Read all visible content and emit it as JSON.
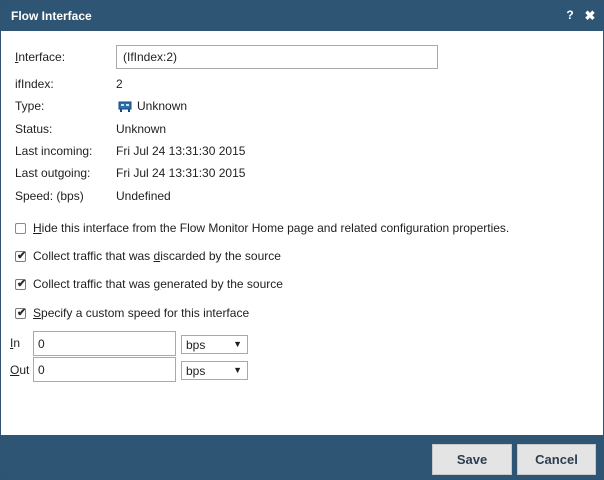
{
  "dialog": {
    "title": "Flow Interface",
    "help": "?",
    "close": "✖"
  },
  "fields": {
    "interface": {
      "label_prefix": "I",
      "label_rest": "nterface:",
      "value": "(IfIndex:2)"
    },
    "ifindex": {
      "label": "ifIndex:",
      "value": "2"
    },
    "type": {
      "label": "Type:",
      "value": "Unknown",
      "icon": "network-card-icon"
    },
    "status": {
      "label": "Status:",
      "value": "Unknown"
    },
    "last_incoming": {
      "label": "Last incoming:",
      "value": "Fri Jul 24 13:31:30 2015"
    },
    "last_outgoing": {
      "label": "Last outgoing:",
      "value": "Fri Jul 24 13:31:30 2015"
    },
    "speed": {
      "label": "Speed: (bps)",
      "value": "Undefined"
    }
  },
  "options": {
    "hide": {
      "checked": false,
      "pre": "",
      "u": "H",
      "post": "ide this interface from the Flow Monitor Home page and related configuration properties."
    },
    "discarded": {
      "checked": true,
      "pre": "Collect traffic that was ",
      "u": "d",
      "post": "iscarded by the source"
    },
    "generated": {
      "checked": true,
      "pre": "Collect traffic that was ",
      "u": "g",
      "post": "enerated by the source"
    },
    "custom_speed": {
      "checked": true,
      "pre": "",
      "u": "S",
      "post": "pecify a custom speed for this interface"
    }
  },
  "speed_in": {
    "label_u": "I",
    "label_rest": "n",
    "value": "0",
    "unit": "bps"
  },
  "speed_out": {
    "label_u": "O",
    "label_rest": "ut",
    "value": "0",
    "unit": "bps"
  },
  "buttons": {
    "save": "Save",
    "cancel": "Cancel"
  },
  "colors": {
    "titlebar": "#2e5573",
    "button_bg": "#e4e4e4"
  }
}
